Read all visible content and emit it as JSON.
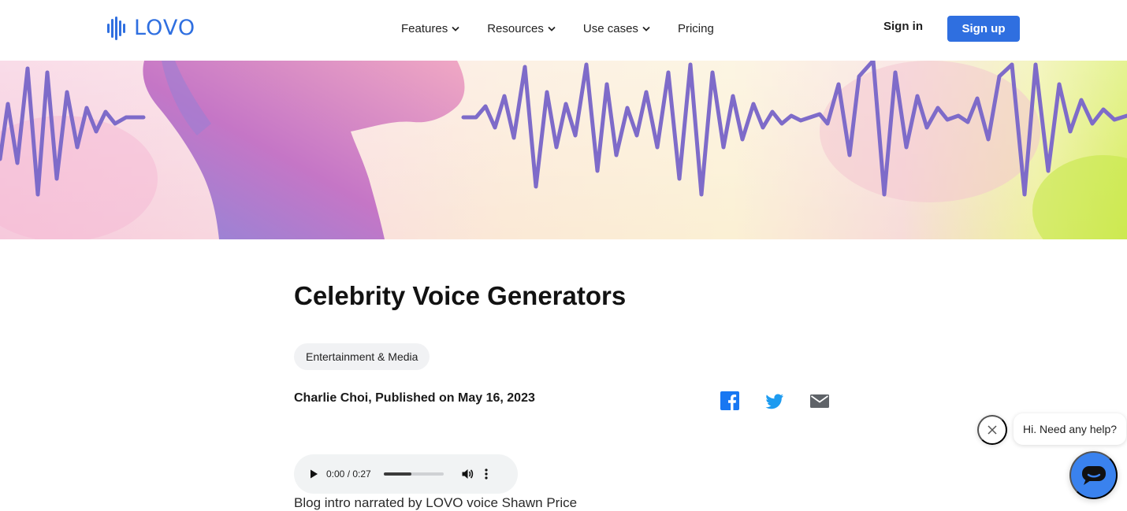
{
  "brand": {
    "name": "LOVO",
    "accent": "#2f6fe0"
  },
  "nav": {
    "items": [
      {
        "label": "Features",
        "has_dropdown": true
      },
      {
        "label": "Resources",
        "has_dropdown": true
      },
      {
        "label": "Use cases",
        "has_dropdown": true
      },
      {
        "label": "Pricing",
        "has_dropdown": false
      }
    ],
    "sign_in": "Sign in",
    "sign_up": "Sign up"
  },
  "hero": {
    "wave_color": "#7e6bc9"
  },
  "article": {
    "title": "Celebrity Voice Generators",
    "tag": "Entertainment & Media",
    "byline": "Charlie Choi, Published on May 16, 2023",
    "share": [
      "facebook-icon",
      "twitter-icon",
      "email-icon"
    ]
  },
  "audio": {
    "time": "0:00 / 0:27",
    "buffered_fraction": 0.47,
    "caption": "Blog intro narrated by LOVO voice Shawn Price"
  },
  "chat": {
    "greeting": "Hi. Need any help?",
    "button_color": "#3a82ee"
  }
}
